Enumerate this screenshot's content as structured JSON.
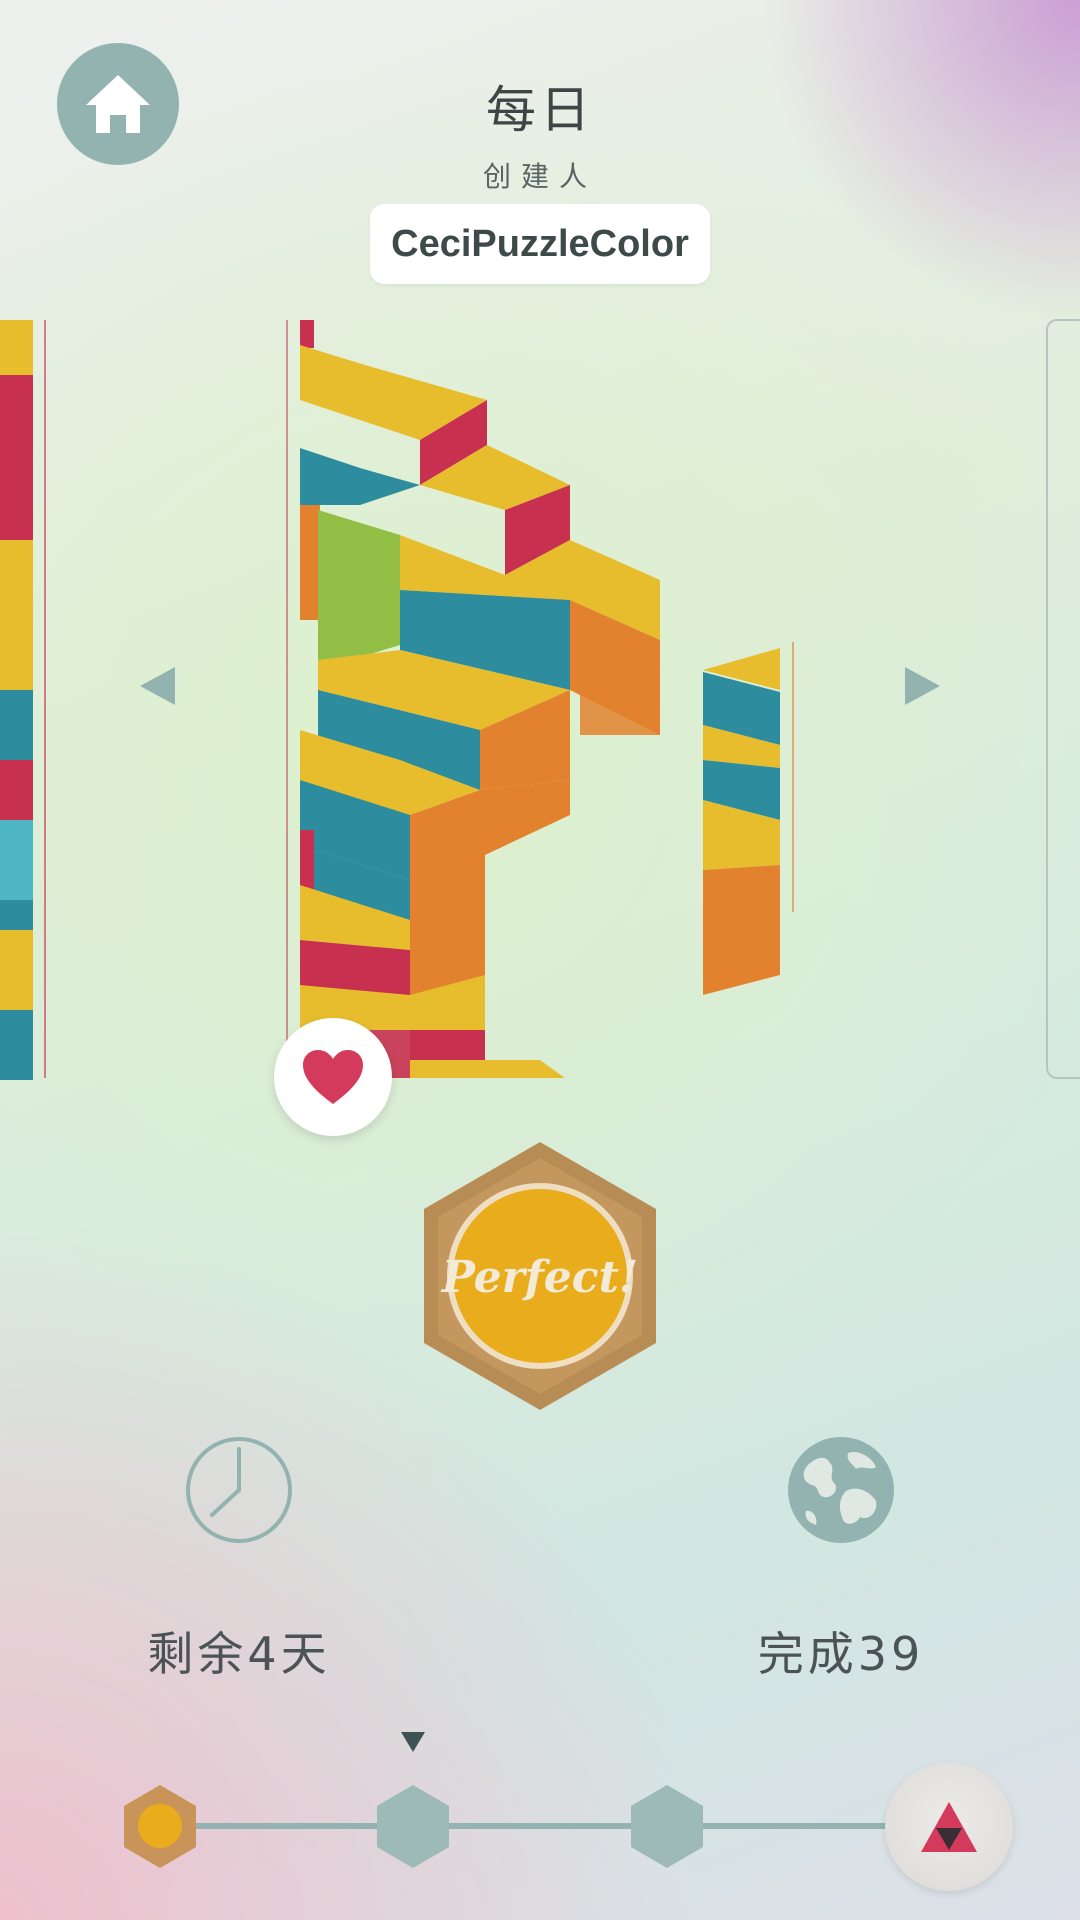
{
  "header": {
    "title": "每日",
    "creator_label": "创建人",
    "creator_name": "CeciPuzzleColor"
  },
  "badge": {
    "text": "Perfect!"
  },
  "stats": {
    "time_left": "剩余4天",
    "completed": "完成39"
  },
  "progress": {
    "current_step": 1,
    "total_steps": 4
  },
  "icons": {
    "home": "home-icon",
    "heart": "heart-icon",
    "clock": "clock-icon",
    "globe": "globe-icon",
    "prev": "arrow-left-icon",
    "next": "arrow-right-icon",
    "triangle": "triangle-icon"
  },
  "colors": {
    "yellow": "#e7bd2e",
    "red": "#c8304f",
    "blue": "#2d8c9e",
    "orange": "#e2822f",
    "green": "#93be46",
    "accent": "#93b3b1",
    "heart": "#d43a5b",
    "gold": "#e9ac1d"
  }
}
